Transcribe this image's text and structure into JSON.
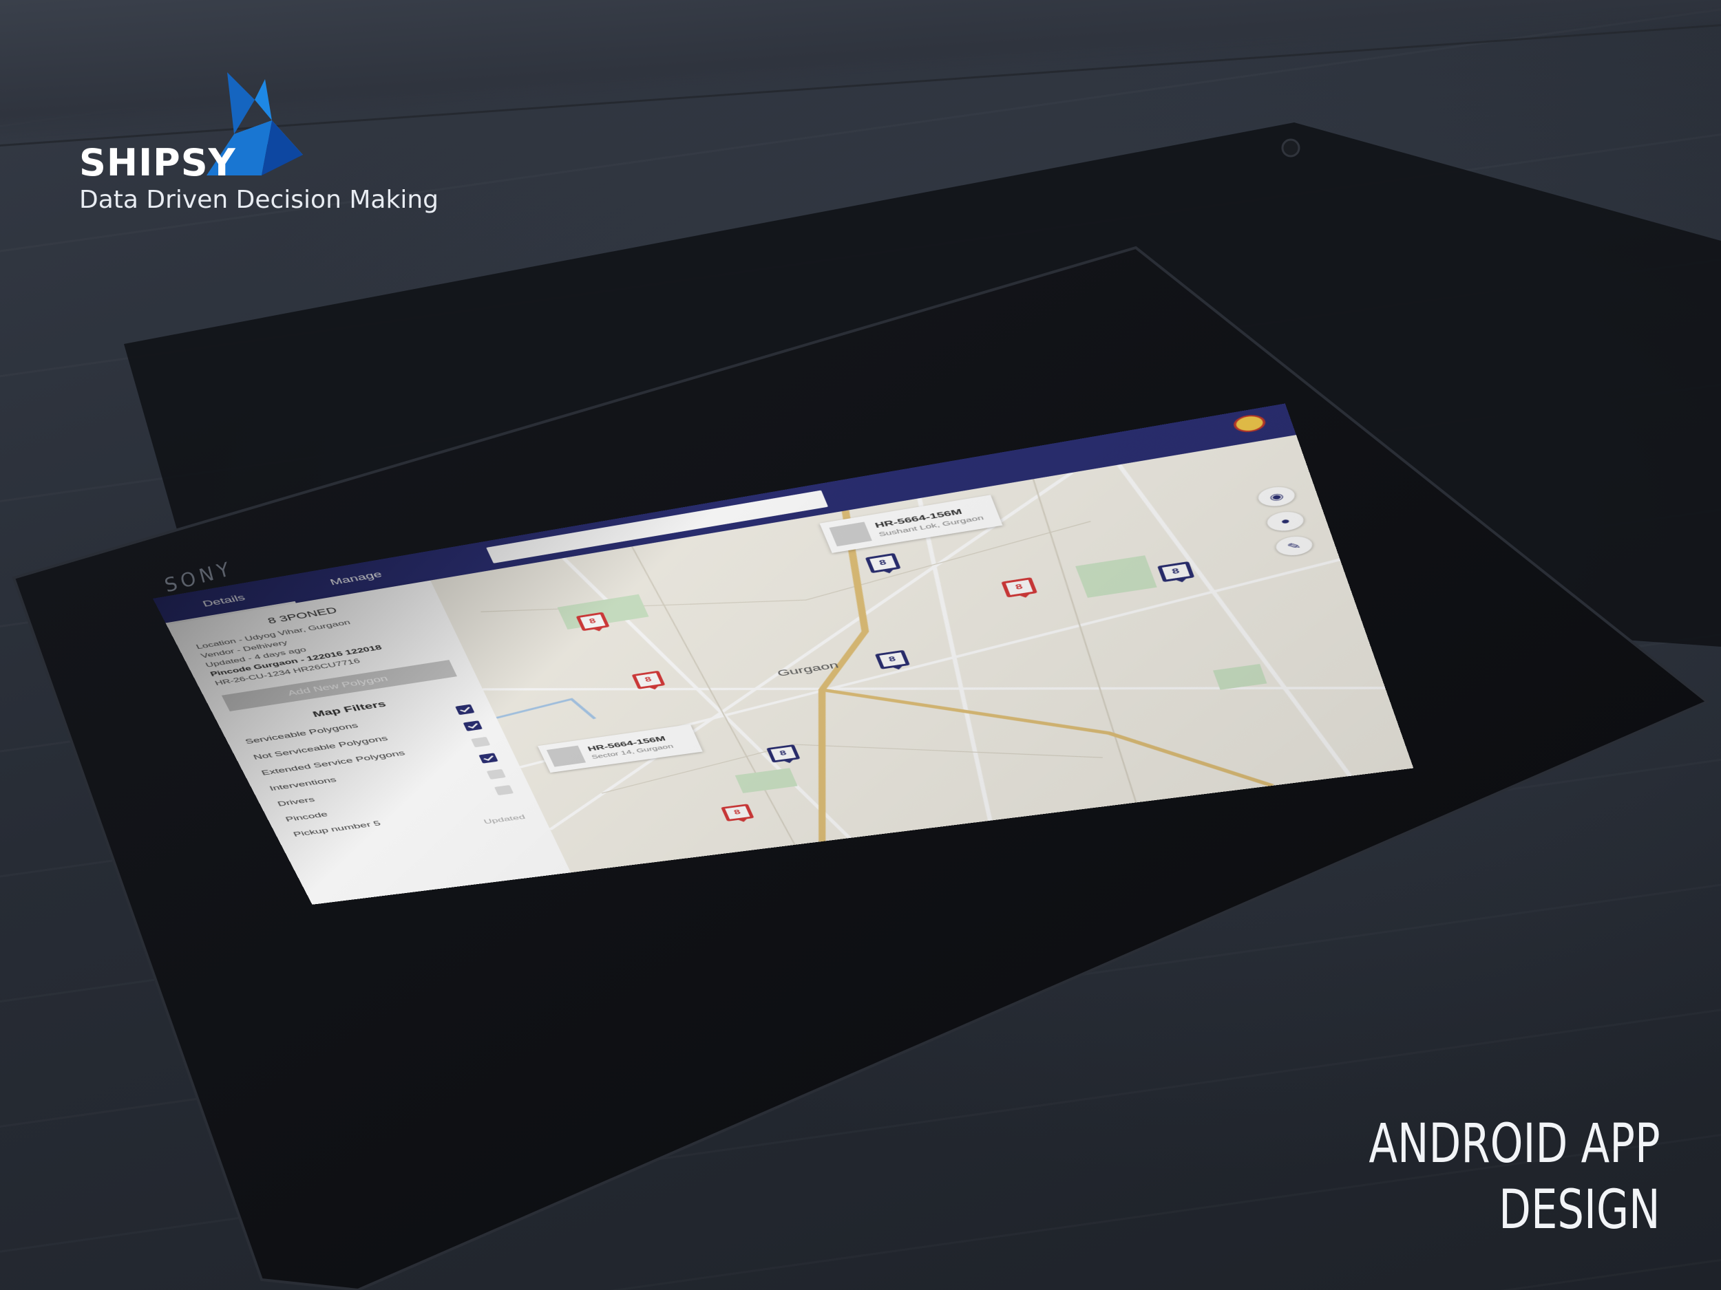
{
  "brand": {
    "name": "SHIPSY",
    "tagline": "Data Driven Decision Making",
    "accent": "#1e88e5"
  },
  "caption": {
    "line1": "ANDROID APP",
    "line2": "DESIGN"
  },
  "device": {
    "maker": "SONY"
  },
  "app": {
    "header_color": "#2b2f73",
    "search": {
      "placeholder": ""
    },
    "tabs": [
      {
        "label": "Details",
        "active": true
      },
      {
        "label": "Manage",
        "active": false
      }
    ],
    "sidebar": {
      "detail_title": "8 3PONED",
      "lines": [
        "Location - Udyog Vihar, Gurgaon",
        "Vendor - Delhivery",
        "Updated - 4 days ago",
        "Pincode Gurgaon - 122016 122018",
        "HR-26-CU-1234 HR26CU7716"
      ],
      "add_button": "Add New Polygon",
      "filters_title": "Map Filters",
      "filters": [
        {
          "label": "Serviceable Polygons",
          "checked": true
        },
        {
          "label": "Not Serviceable Polygons",
          "checked": true
        },
        {
          "label": "Extended Service Polygons",
          "checked": false
        },
        {
          "label": "Interventions",
          "checked": true
        },
        {
          "label": "Drivers",
          "checked": false
        },
        {
          "label": "Pincode",
          "checked": false
        },
        {
          "label": "Pickup number 5",
          "checked": false
        }
      ],
      "footer_text": "Updated"
    },
    "map": {
      "city_label": "Gurgaon",
      "callouts": [
        {
          "id": "HR-5664-156M",
          "sub": "Sushant Lok, Gurgaon"
        },
        {
          "id": "HR-5664-156M",
          "sub": "Sector 14, Gurgaon"
        }
      ],
      "pins": [
        {
          "color": "red",
          "glyph": "8"
        },
        {
          "color": "blue",
          "glyph": "8"
        },
        {
          "color": "red",
          "glyph": "8"
        },
        {
          "color": "red",
          "glyph": "8"
        },
        {
          "color": "blue",
          "glyph": "8"
        },
        {
          "color": "blue",
          "glyph": "8"
        },
        {
          "color": "blue",
          "glyph": "8"
        },
        {
          "color": "red",
          "glyph": "8"
        }
      ],
      "controls": [
        "layers-icon",
        "location-icon",
        "draw-icon"
      ]
    }
  }
}
